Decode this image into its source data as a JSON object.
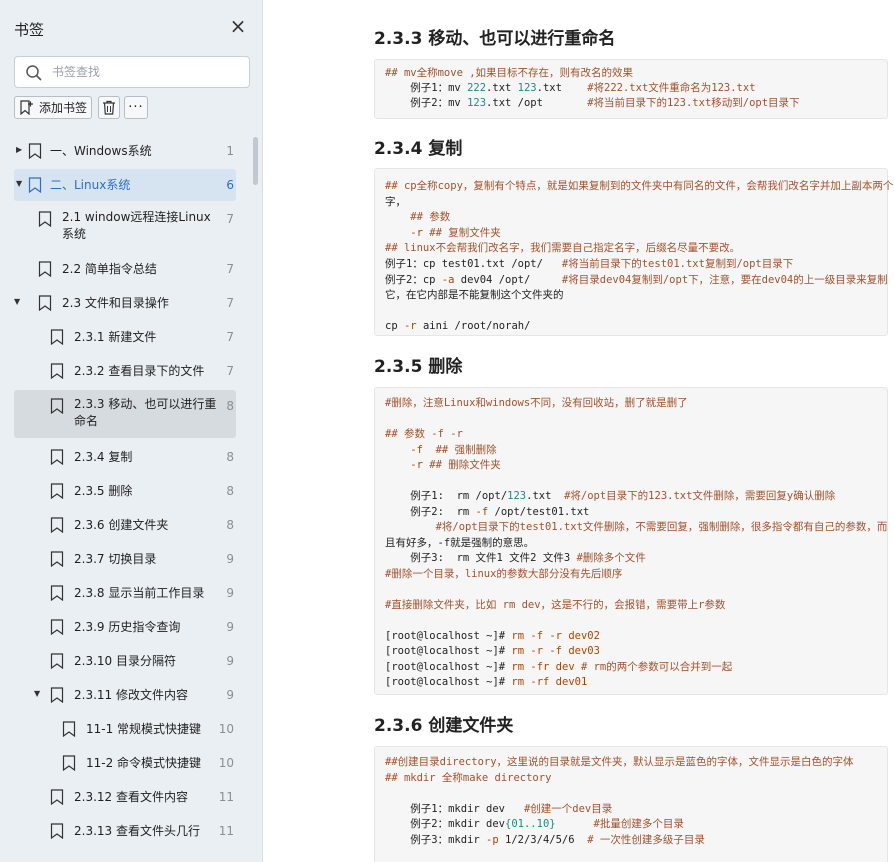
{
  "sidebar": {
    "title": "书签",
    "search_placeholder": "书签查找",
    "toolbar": {
      "add_label": "添加书签",
      "more_label": "···"
    },
    "items": [
      {
        "label": "一、Windows系统",
        "page": "1"
      },
      {
        "label": "二、Linux系统",
        "page": "6"
      },
      {
        "label": "2.1 window远程连接Linux",
        "label2": "系统",
        "page": "7"
      },
      {
        "label": "2.2 简单指令总结",
        "page": "7"
      },
      {
        "label": "2.3 文件和目录操作",
        "page": "7"
      },
      {
        "label": "2.3.1 新建文件",
        "page": "7"
      },
      {
        "label": "2.3.2 查看目录下的文件",
        "page": "7"
      },
      {
        "label": "2.3.3 移动、也可以进行重",
        "label2": "命名",
        "page": "8"
      },
      {
        "label": "2.3.4 复制",
        "page": "8"
      },
      {
        "label": "2.3.5 删除",
        "page": "8"
      },
      {
        "label": "2.3.6 创建文件夹",
        "page": "8"
      },
      {
        "label": "2.3.7 切换目录",
        "page": "9"
      },
      {
        "label": "2.3.8 显示当前工作目录",
        "page": "9"
      },
      {
        "label": "2.3.9 历史指令查询",
        "page": "9"
      },
      {
        "label": "2.3.10 目录分隔符",
        "page": "9"
      },
      {
        "label": "2.3.11 修改文件内容",
        "page": "9"
      },
      {
        "label": "11-1 常规模式快捷键",
        "page": "10"
      },
      {
        "label": "11-2 命令模式快捷键",
        "page": "10"
      },
      {
        "label": "2.3.12 查看文件内容",
        "page": "11"
      },
      {
        "label": "2.3.13 查看文件头几行",
        "page": "11"
      }
    ]
  },
  "content": {
    "sections": [
      {
        "title": "2.3.3 移动、也可以进行重命名",
        "lines": [
          "## mv全称move ,如果目标不存在，则有改名的效果",
          "    例子1：mv 222.txt 123.txt    #将222.txt文件重命名为123.txt",
          "    例子2：mv 123.txt /opt       #将当前目录下的123.txt移动到/opt目录下"
        ]
      },
      {
        "title": "2.3.4 复制",
        "lines": [
          "## cp全称copy，复制有个特点，就是如果复制到的文件夹中有同名的文件，会帮我们改名字并加上副本两个",
          "字，",
          "    ## 参数",
          "    -r ## 复制文件夹",
          "## linux不会帮我们改名字，我们需要自己指定名字，后缀名尽量不要改。",
          "例子1：cp test01.txt /opt/   #将当前目录下的test01.txt复制到/opt目录下",
          "例子2：cp -a dev04 /opt/     #将目录dev04复制到/opt下，注意，要在dev04的上一级目录来复制",
          "它，在它内部是不能复制这个文件夹的",
          "",
          "cp -r aini /root/norah/"
        ]
      },
      {
        "title": "2.3.5 删除",
        "lines": [
          "#删除，注意Linux和windows不同，没有回收站，删了就是删了",
          "",
          "## 参数 -f -r",
          "    -f  ## 强制删除",
          "    -r ## 删除文件夹",
          "",
          "    例子1:  rm /opt/123.txt  #将/opt目录下的123.txt文件删除，需要回复y确认删除",
          "    例子2:  rm -f /opt/test01.txt",
          "        #将/opt目录下的test01.txt文件删除，不需要回复，强制删除，很多指令都有自己的参数，而",
          "且有好多，-f就是强制的意思。",
          "    例子3:  rm 文件1 文件2 文件3 #删除多个文件",
          "#删除一个目录，linux的参数大部分没有先后顺序",
          "",
          "#直接删除文件夹，比如 rm dev，这是不行的，会报错，需要带上r参数",
          "",
          "[root@localhost ~]# rm -f -r dev02",
          "[root@localhost ~]# rm -r -f dev03",
          "[root@localhost ~]# rm -fr dev # rm的两个参数可以合并到一起",
          "[root@localhost ~]# rm -rf dev01"
        ]
      },
      {
        "title": "2.3.6 创建文件夹",
        "lines": [
          "##创建目录directory，这里说的目录就是文件夹，默认显示是蓝色的字体，文件显示是白色的字体",
          "## mkdir 全称make directory",
          "",
          "    例子1：mkdir dev   #创建一个dev目录",
          "    例子2：mkdir dev{01..10}      #批量创建多个目录",
          "    例子3：mkdir -p 1/2/3/4/5/6  # 一次性创建多级子目录"
        ]
      }
    ]
  }
}
